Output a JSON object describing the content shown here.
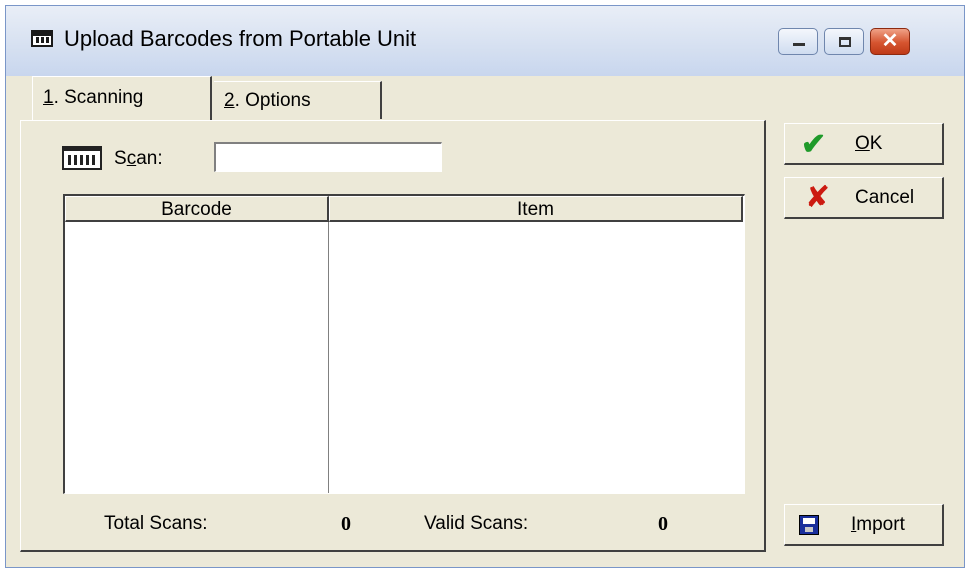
{
  "window": {
    "title": "Upload Barcodes from Portable Unit",
    "close_glyph": "✕"
  },
  "tabs": [
    {
      "accel": "1",
      "rest": ". Scanning",
      "active": true
    },
    {
      "accel": "2",
      "rest": ". Options",
      "active": false
    }
  ],
  "scan": {
    "label_pre": "S",
    "label_accel": "c",
    "label_post": "an:",
    "value": "",
    "icon": "barcode-scanner-icon"
  },
  "grid": {
    "columns": [
      "Barcode",
      "Item"
    ],
    "rows": []
  },
  "footer": {
    "total_label": "Total Scans:",
    "total_value": "0",
    "valid_label": "Valid Scans:",
    "valid_value": "0"
  },
  "buttons": {
    "ok": {
      "accel": "O",
      "rest": "K",
      "icon": "check-icon"
    },
    "cancel": {
      "label": "Cancel",
      "icon": "x-icon"
    },
    "import": {
      "accel": "I",
      "rest": "mport",
      "icon": "floppy-disk-icon"
    }
  },
  "colors": {
    "check": "#1f9a2a",
    "cancel_x": "#cc1a10",
    "disk": "#1a2f9c",
    "close_button": "#d5542f"
  }
}
